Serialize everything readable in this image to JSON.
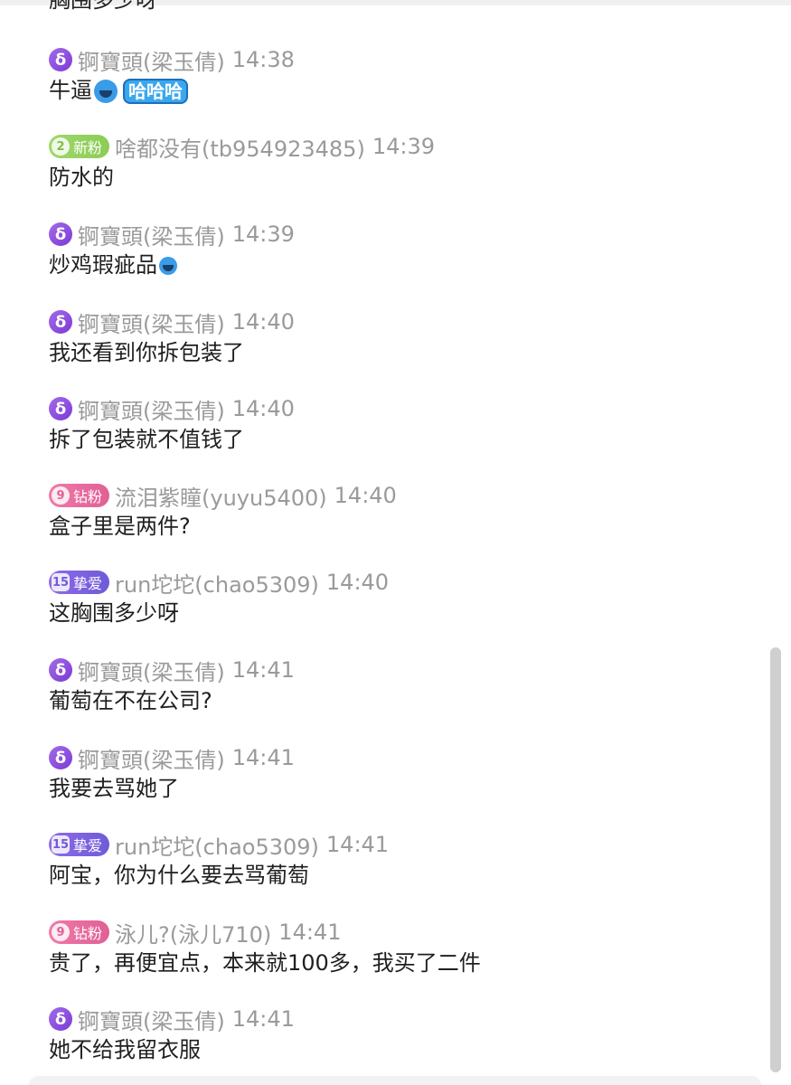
{
  "top_fragment": "胸围多少呀",
  "messages": [
    {
      "badge": "host",
      "name": "锕寶頭(梁玉倩)",
      "time": "14:38",
      "text": "牛逼",
      "emoji": "laughing-emoji",
      "sticker": "哈哈哈"
    },
    {
      "badge": "new",
      "level": "2",
      "level_label": "新粉",
      "name": "啥都没有(tb954923485)",
      "time": "14:39",
      "text": "防水的"
    },
    {
      "badge": "host",
      "name": "锕寶頭(梁玉倩)",
      "time": "14:39",
      "text": "炒鸡瑕疵品",
      "emoji": "laughing-emoji"
    },
    {
      "badge": "host",
      "name": "锕寶頭(梁玉倩)",
      "time": "14:40",
      "text": "我还看到你拆包装了"
    },
    {
      "badge": "host",
      "name": "锕寶頭(梁玉倩)",
      "time": "14:40",
      "text": "拆了包装就不值钱了"
    },
    {
      "badge": "diamond",
      "level": "9",
      "level_label": "钻粉",
      "name": "流泪紫瞳(yuyu5400)",
      "time": "14:40",
      "text": "盒子里是两件?"
    },
    {
      "badge": "love",
      "level": "15",
      "level_label": "挚爱",
      "name": "run坨坨(chao5309)",
      "time": "14:40",
      "text": "这胸围多少呀"
    },
    {
      "badge": "host",
      "name": "锕寶頭(梁玉倩)",
      "time": "14:41",
      "text": "葡萄在不在公司?"
    },
    {
      "badge": "host",
      "name": "锕寶頭(梁玉倩)",
      "time": "14:41",
      "text": "我要去骂她了"
    },
    {
      "badge": "love",
      "level": "15",
      "level_label": "挚爱",
      "name": "run坨坨(chao5309)",
      "time": "14:41",
      "text": "阿宝，你为什么要去骂葡萄"
    },
    {
      "badge": "diamond",
      "level": "9",
      "level_label": "钻粉",
      "name": "泳儿?(泳儿710)",
      "time": "14:41",
      "text": "贵了，再便宜点，本来就100多，我买了二件"
    },
    {
      "badge": "host",
      "name": "锕寶頭(梁玉倩)",
      "time": "14:41",
      "text": "她不给我留衣服"
    }
  ],
  "host_badge_glyph": "δ",
  "colors": {
    "meta_text": "#9a9a9a",
    "message_text": "#1f1f1f",
    "host_badge": "#8a4be0",
    "new_fan_badge": "#8ccc56",
    "diamond_fan_badge": "#e06096",
    "love_fan_badge": "#6e5bd8",
    "scrollbar": "#cfcfcf"
  }
}
